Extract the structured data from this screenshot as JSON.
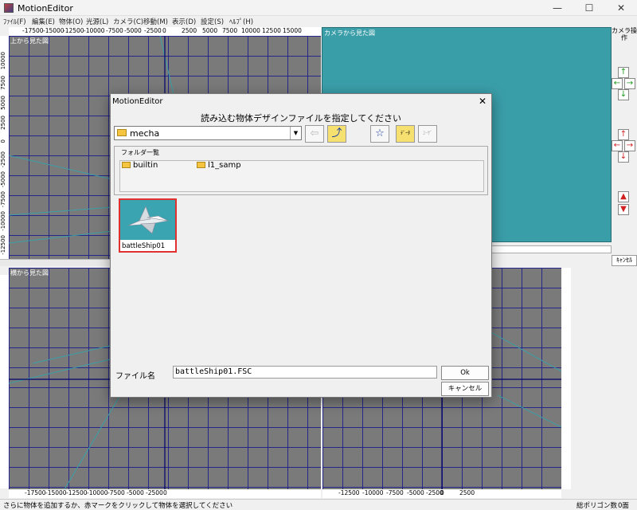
{
  "window": {
    "title": "MotionEditor",
    "minimize": "—",
    "maximize": "☐",
    "close": "✕"
  },
  "menu": [
    "ﾌｧｲﾙ(F)",
    "編集(E)",
    "物体(O)",
    "光源(L)",
    "カメラ(C)",
    "移動(M)",
    "表示(D)",
    "設定(S)",
    "ﾍﾙﾌﾟ(H)"
  ],
  "panels": {
    "top_title": "上から見た図",
    "side_title": "横から見た図",
    "camera_title": "カメラから見た図"
  },
  "ruler": {
    "top_h": [
      "-17500",
      "-15000",
      "-12500",
      "-10000",
      "-7500",
      "-5000",
      "-2500",
      "0",
      "2500",
      "5000",
      "7500",
      "10000",
      "12500",
      "15000"
    ],
    "top_v": [
      "10000",
      "7500",
      "5000",
      "2500",
      "0",
      "-2500",
      "-5000",
      "-7500",
      "-10000",
      "-12500"
    ],
    "bottom_h_left": [
      "-17500",
      "-15000",
      "-12500",
      "-10000",
      "-7500",
      "-5000",
      "-2500",
      "0"
    ],
    "bottom_h_right": [
      "-12500",
      "-10000",
      "-7500",
      "-5000",
      "-2500",
      "0",
      "2500"
    ]
  },
  "camera_controls": {
    "label": "カメラ操作",
    "cancel": "ｷｬﾝｾﾙ"
  },
  "dialog": {
    "title": "MotionEditor",
    "close": "✕",
    "heading": "読み込む物体デザインファイルを指定してください",
    "folder_value": "mecha",
    "folder_group_label": "フォルダ一覧",
    "folders": [
      "builtin",
      "l1_samp"
    ],
    "toolbar": {
      "datafolder_label": "ﾃﾞｰﾀ",
      "userfolder_label": "ﾕｰｻﾞ"
    },
    "files": [
      {
        "name": "battleShip01"
      }
    ],
    "filename_label": "ファイル名",
    "filename_value": "battleShip01.FSC",
    "ok_label": "Ok",
    "cancel_label": "キャンセル"
  },
  "status": {
    "message": "さらに物体を追加するか、赤マークをクリックして物体を選択してください",
    "polygon_label": "総ポリゴン数",
    "polygon_value": "0面"
  },
  "colors": {
    "camera_bg": "#3a9ea9",
    "grid": "#1e1e8c",
    "viewport_bg": "#7a7a7a",
    "selection": "#e03030"
  }
}
